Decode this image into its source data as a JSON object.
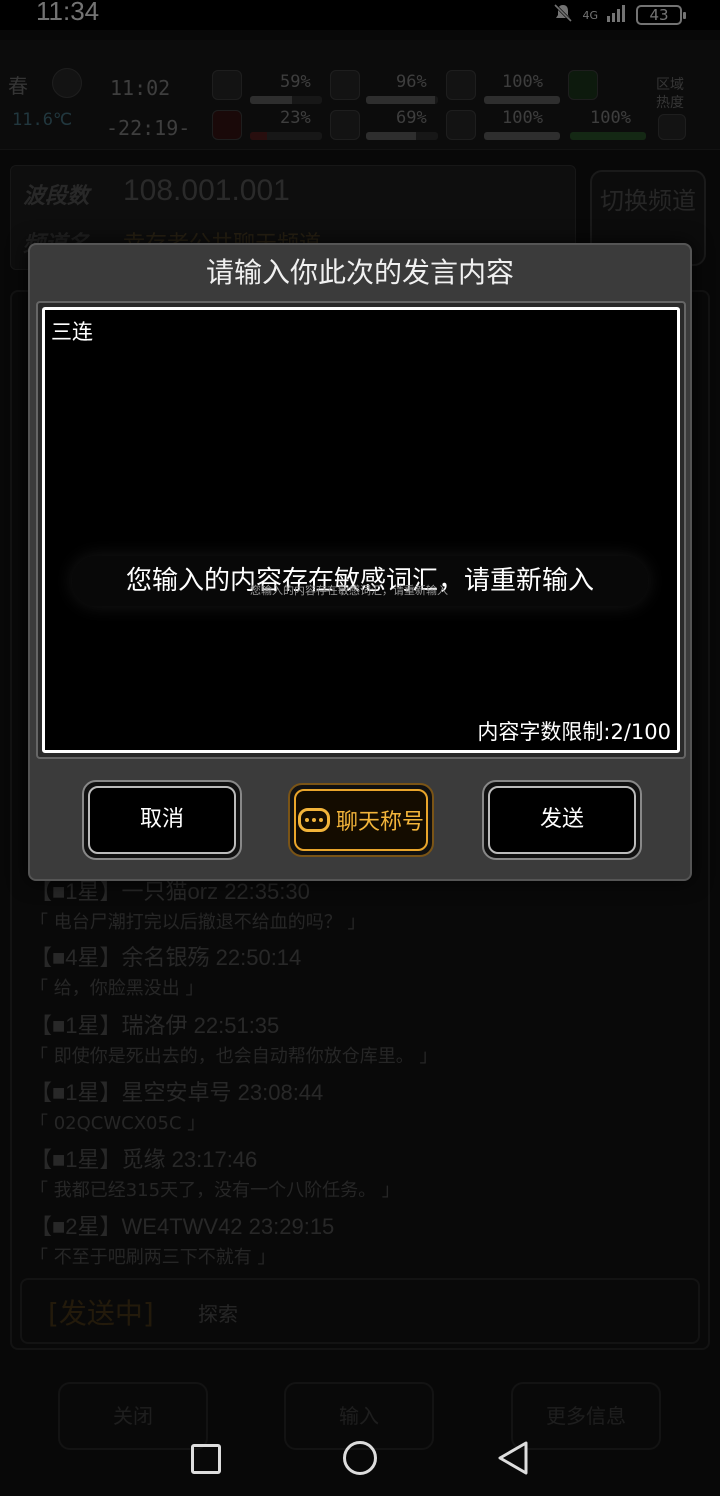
{
  "status_bar": {
    "time": "11:34",
    "network": "4G",
    "battery": "43"
  },
  "hud": {
    "season": "春",
    "temperature": "11.6℃",
    "time_a": "11:02",
    "time_b": "-22:19-",
    "stat1_top": "59%",
    "stat1_bottom": "23%",
    "stat2_top": "96%",
    "stat2_bottom": "69%",
    "stat3_top": "100%",
    "stat3_bottom": "100%",
    "stat4_bottom": "100%",
    "region_label": "区域热度"
  },
  "radio": {
    "band_label": "波段数",
    "frequency": "108.001.001",
    "channel_label": "频道名",
    "channel_name": "幸存者公共聊天频道",
    "switch_label": "切换频道"
  },
  "chat_messages": [
    {
      "head": "【■1星】一只猫orz 22:35:30",
      "body": "「 电台尸潮打完以后撤退不给血的吗？ 」"
    },
    {
      "head": "【■4星】余名银殇 22:50:14",
      "body": "「 给，你脸黑没出 」"
    },
    {
      "head": "【■1星】瑞洛伊 22:51:35",
      "body": "「 即使你是死出去的，也会自动帮你放仓库里。 」"
    },
    {
      "head": "【■1星】星空安卓号 23:08:44",
      "body": "「 02QCWCX05C 」"
    },
    {
      "head": "【■1星】觅缘 23:17:46",
      "body": "「 我都已经315天了，没有一个八阶任务。 」"
    },
    {
      "head": "【■2星】WE4TWV42 23:29:15",
      "body": "「 不至于吧刷两三下不就有 」"
    }
  ],
  "send_row": {
    "status": "[发送中]",
    "text": "探索"
  },
  "bottom_buttons": {
    "close": "关闭",
    "input": "输入",
    "more": "更多信息"
  },
  "dialog": {
    "title": "请输入你此次的发言内容",
    "input_value": "三连",
    "counter": "内容字数限制:2/100",
    "toast": "您输入的内容存在敏感词汇，请重新输入",
    "toast_echo": "您输入的内容存在敏感词汇，请重新输入",
    "cancel_label": "取消",
    "nickname_label": "聊天称号",
    "send_label": "发送"
  },
  "colors": {
    "accent_gold": "#f2b43a",
    "dialog_bg": "#3b3b3b"
  }
}
